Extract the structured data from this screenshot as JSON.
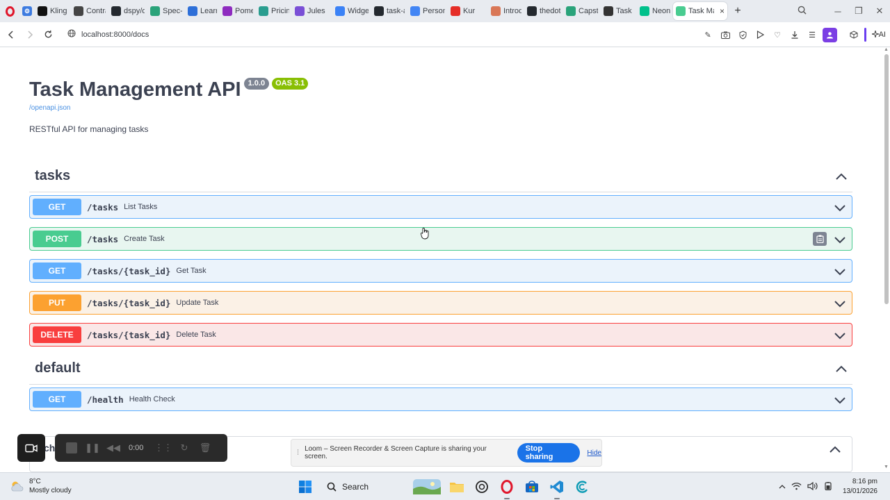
{
  "browser": {
    "tabs": [
      {
        "label": "Kling",
        "icon": "kling-icon",
        "color": "#111111"
      },
      {
        "label": "Contra",
        "icon": "contra-icon",
        "color": "#444444"
      },
      {
        "label": "dspy/d",
        "icon": "github-icon",
        "color": "#24292f"
      },
      {
        "label": "Spec-D",
        "icon": "spec-icon",
        "color": "#2aa37a"
      },
      {
        "label": "Learn",
        "icon": "k-icon",
        "color": "#2e6fd8"
      },
      {
        "label": "Pomel",
        "icon": "pomelli-icon",
        "color": "#8e2bbf"
      },
      {
        "label": "Pricing",
        "icon": "plus-grid-icon",
        "color": "#2a9d8f"
      },
      {
        "label": "Jules",
        "icon": "jules-icon",
        "color": "#7a4fd6"
      },
      {
        "label": "Widge",
        "icon": "widget-icon",
        "color": "#3b82f6"
      },
      {
        "label": "task-a",
        "icon": "github-icon",
        "color": "#24292f"
      },
      {
        "label": "Person",
        "icon": "docs-icon",
        "color": "#4285f4"
      },
      {
        "label": "Kur",
        "icon": "youtube-icon",
        "color": "#e52d27"
      },
      {
        "label": "Introd",
        "icon": "asterisk-icon",
        "color": "#d97757"
      },
      {
        "label": "thedot",
        "icon": "github-icon",
        "color": "#24292f"
      },
      {
        "label": "Capsto",
        "icon": "capstone-icon",
        "color": "#2aa37a"
      },
      {
        "label": "Task M",
        "icon": "chatgpt-icon",
        "color": "#333333"
      },
      {
        "label": "Neon",
        "icon": "neon-icon",
        "color": "#00c08b"
      },
      {
        "label": "Task Man",
        "icon": "swagger-icon",
        "color": "#49cc90",
        "active": true
      }
    ],
    "close_tab_label": "×",
    "new_tab_label": "+",
    "url": "localhost:8000/docs",
    "ai_label": "AI"
  },
  "api": {
    "title": "Task Management API",
    "version": "1.0.0",
    "oas": "OAS 3.1",
    "openapi_link": "/openapi.json",
    "description": "RESTful API for managing tasks"
  },
  "sections": [
    {
      "name": "tasks",
      "operations": [
        {
          "method": "GET",
          "path": "/tasks",
          "summary": "List Tasks"
        },
        {
          "method": "POST",
          "path": "/tasks",
          "summary": "Create Task"
        },
        {
          "method": "GET",
          "path": "/tasks/{task_id}",
          "summary": "Get Task"
        },
        {
          "method": "PUT",
          "path": "/tasks/{task_id}",
          "summary": "Update Task"
        },
        {
          "method": "DELETE",
          "path": "/tasks/{task_id}",
          "summary": "Delete Task"
        }
      ]
    },
    {
      "name": "default",
      "operations": [
        {
          "method": "GET",
          "path": "/health",
          "summary": "Health Check"
        }
      ]
    }
  ],
  "schemas_partial": "ch",
  "loom": {
    "time": "0:00",
    "notice": "Loom – Screen Recorder & Screen Capture is sharing your screen.",
    "stop_label": "Stop sharing",
    "hide_label": "Hide"
  },
  "taskbar": {
    "temperature": "8°C",
    "weather": "Mostly cloudy",
    "search_label": "Search",
    "time": "8:16 pm",
    "date": "13/01/2026"
  },
  "colors": {
    "get": "#61affe",
    "post": "#49cc90",
    "put": "#fca130",
    "delete": "#f93e3e",
    "version_badge": "#7d8492",
    "oas_badge": "#89bf04",
    "stop_sharing": "#1a73e8"
  }
}
